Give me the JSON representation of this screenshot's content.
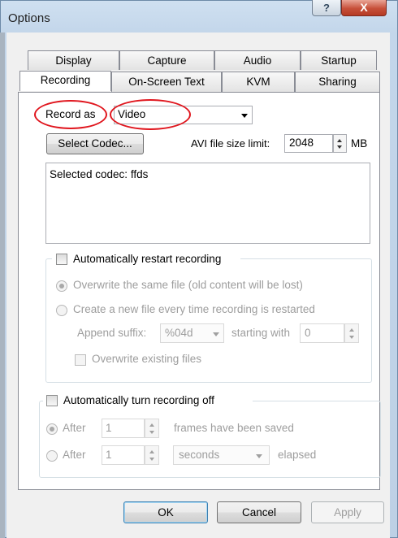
{
  "window": {
    "title": "Options",
    "help_glyph": "?",
    "close_glyph": "X"
  },
  "tabs_top": [
    "Display",
    "Capture",
    "Audio",
    "Startup"
  ],
  "tabs_bottom": [
    "Recording",
    "On-Screen Text",
    "KVM",
    "Sharing"
  ],
  "selected_tab": "Recording",
  "record": {
    "label": "Record as",
    "type_value": "Video",
    "select_codec_label": "Select Codec...",
    "avi_limit_label": "AVI file size limit:",
    "avi_limit_value": "2048",
    "avi_limit_unit": "MB",
    "codec_info": "Selected codec: ffds"
  },
  "restart": {
    "label": "Automatically restart recording",
    "checked": false,
    "overwrite_option": "Overwrite the same file (old content will be lost)",
    "create_option": "Create a new file every time recording is restarted",
    "append_suffix_label": "Append suffix:",
    "suffix_value": "%04d",
    "starting_with_label": "starting with",
    "starting_with_value": "0",
    "overwrite_existing_label": "Overwrite existing files",
    "overwrite_existing_checked": false
  },
  "turnoff": {
    "label": "Automatically turn recording off",
    "checked": false,
    "after1_label": "After",
    "after1_value": "1",
    "after1_suffix": "frames have been saved",
    "after2_label": "After",
    "after2_value": "1",
    "unit_value": "seconds",
    "elapsed_label": "elapsed"
  },
  "buttons": {
    "ok": "OK",
    "cancel": "Cancel",
    "apply": "Apply"
  },
  "annotation_color": "#e0161e"
}
